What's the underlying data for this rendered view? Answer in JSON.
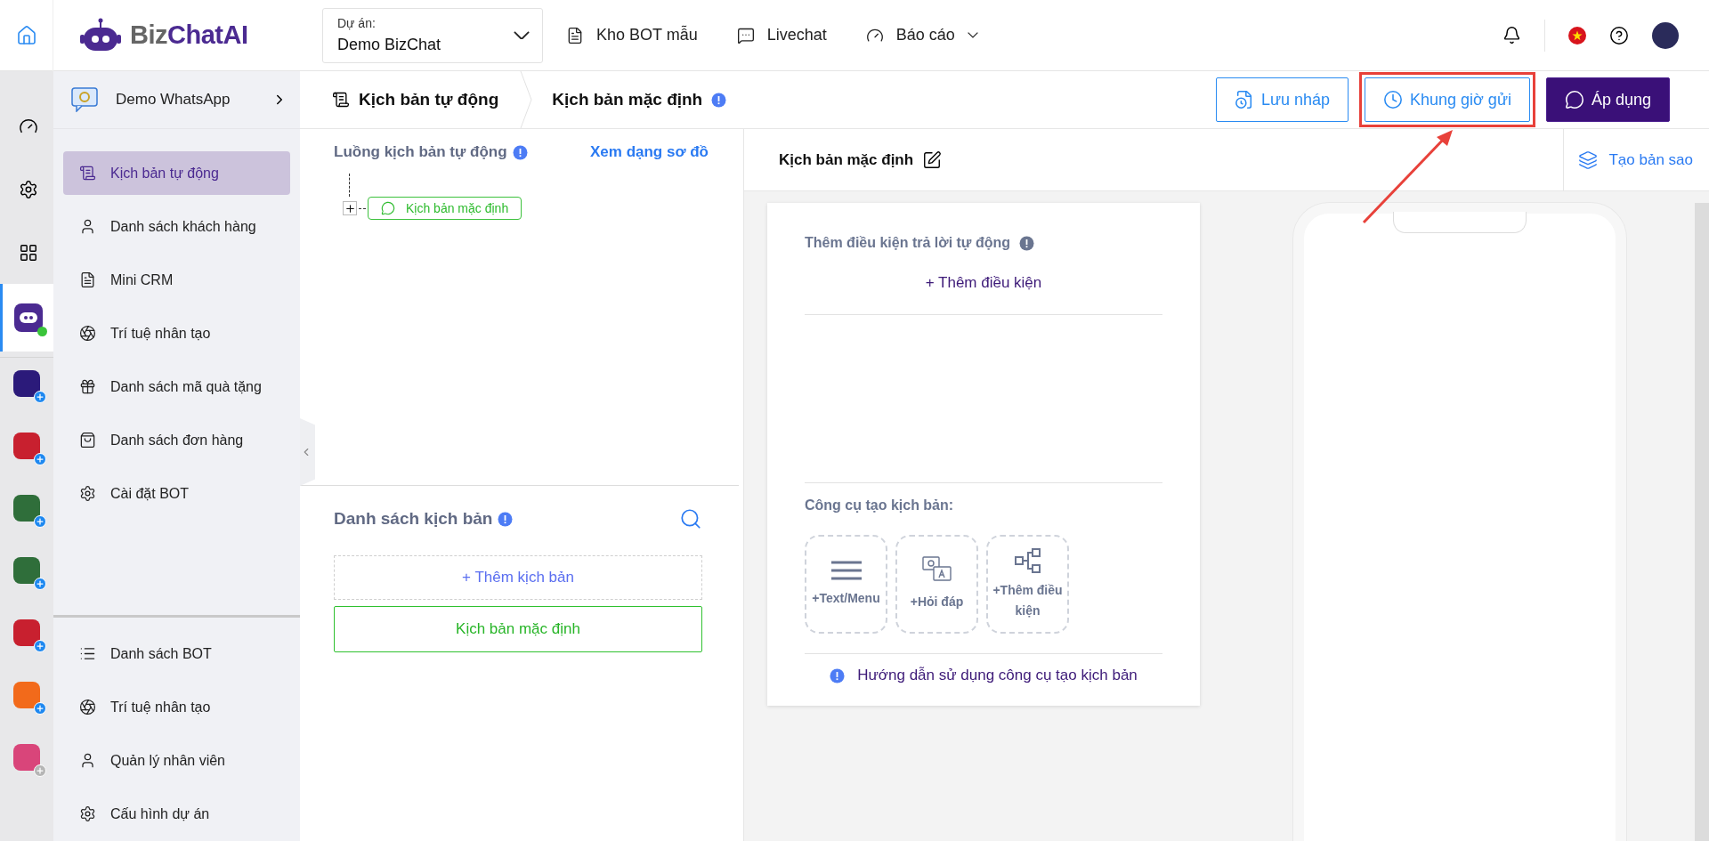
{
  "topbar": {
    "logo": {
      "prefix": "Biz",
      "name": "ChatAI"
    },
    "project": {
      "label": "Dự án:",
      "value": "Demo BizChat"
    },
    "nav": [
      {
        "kind": "template",
        "label": "Kho BOT mẫu"
      },
      {
        "kind": "chat",
        "label": "Livechat"
      },
      {
        "kind": "report",
        "label": "Báo cáo",
        "dropdown": true
      }
    ]
  },
  "rail": [
    {
      "kind": "dashboard",
      "selected": false
    },
    {
      "kind": "settings",
      "selected": false
    },
    {
      "kind": "grid",
      "selected": false
    },
    {
      "kind": "bot",
      "selected": true,
      "online": true
    }
  ],
  "rail_apps": [
    {
      "color": "#2b1a7a",
      "enabled": true
    },
    {
      "color": "#c8202f",
      "enabled": true
    },
    {
      "color": "#2f6e3a",
      "enabled": true
    },
    {
      "color": "#2f6e3a",
      "enabled": true
    },
    {
      "color": "#c8202f",
      "enabled": true
    },
    {
      "color": "#f26a1b",
      "enabled": true
    },
    {
      "color": "#d9457a",
      "enabled": false
    }
  ],
  "sidebar": {
    "bot_name": "Demo WhatsApp",
    "items": [
      {
        "kind": "script",
        "label": "Kịch bản tự động",
        "selected": true
      },
      {
        "kind": "user",
        "label": "Danh sách khách hàng",
        "selected": false
      },
      {
        "kind": "crm",
        "label": "Mini CRM",
        "selected": false
      },
      {
        "kind": "ai",
        "label": "Trí tuệ nhân tạo",
        "selected": false
      },
      {
        "kind": "gift",
        "label": "Danh sách mã quà tặng",
        "selected": false
      },
      {
        "kind": "bag",
        "label": "Danh sách đơn hàng",
        "selected": false
      },
      {
        "kind": "settings",
        "label": "Cài đặt BOT",
        "selected": false
      }
    ],
    "bottom_items": [
      {
        "kind": "list",
        "label": "Danh sách BOT",
        "selected": false
      },
      {
        "kind": "ai",
        "label": "Trí tuệ nhân tạo",
        "selected": false
      },
      {
        "kind": "user",
        "label": "Quản lý nhân viên",
        "selected": false
      },
      {
        "kind": "settings",
        "label": "Cấu hình dự án",
        "selected": false
      }
    ]
  },
  "header": {
    "breadcrumb": [
      "Kịch bản tự động",
      "Kịch bản mặc định"
    ],
    "buttons": [
      {
        "kind": "draft",
        "label": "Lưu nháp",
        "highlighted": false
      },
      {
        "kind": "schedule",
        "label": "Khung giờ gửi",
        "highlighted": true
      },
      {
        "kind": "apply",
        "label": "Áp dụng",
        "highlighted": false
      }
    ]
  },
  "flow": {
    "title": "Luồng kịch bản tự động",
    "view_link": "Xem dạng sơ đồ",
    "tree": [
      {
        "label": "Kịch bản mặc định",
        "expanded": false
      }
    ]
  },
  "scripts": {
    "title": "Danh sách kịch bản",
    "add": "+ Thêm kịch bản",
    "items": [
      {
        "label": "Kịch bản mặc định",
        "selected": true
      }
    ]
  },
  "editor": {
    "title": "Kịch bản mặc định",
    "copy": "Tạo bản sao",
    "conditions_title": "Thêm điều kiện trả lời tự động",
    "add_condition": "+ Thêm điều kiện",
    "tools_title": "Công cụ tạo kịch bản:",
    "tools": [
      {
        "kind": "menu",
        "label": "+Text/Menu"
      },
      {
        "kind": "qa",
        "label": "+Hỏi đáp"
      },
      {
        "kind": "condition",
        "label": "+Thêm điều kiện"
      }
    ],
    "guide": "Hướng dẫn sử dụng công cụ tạo kịch bản"
  }
}
